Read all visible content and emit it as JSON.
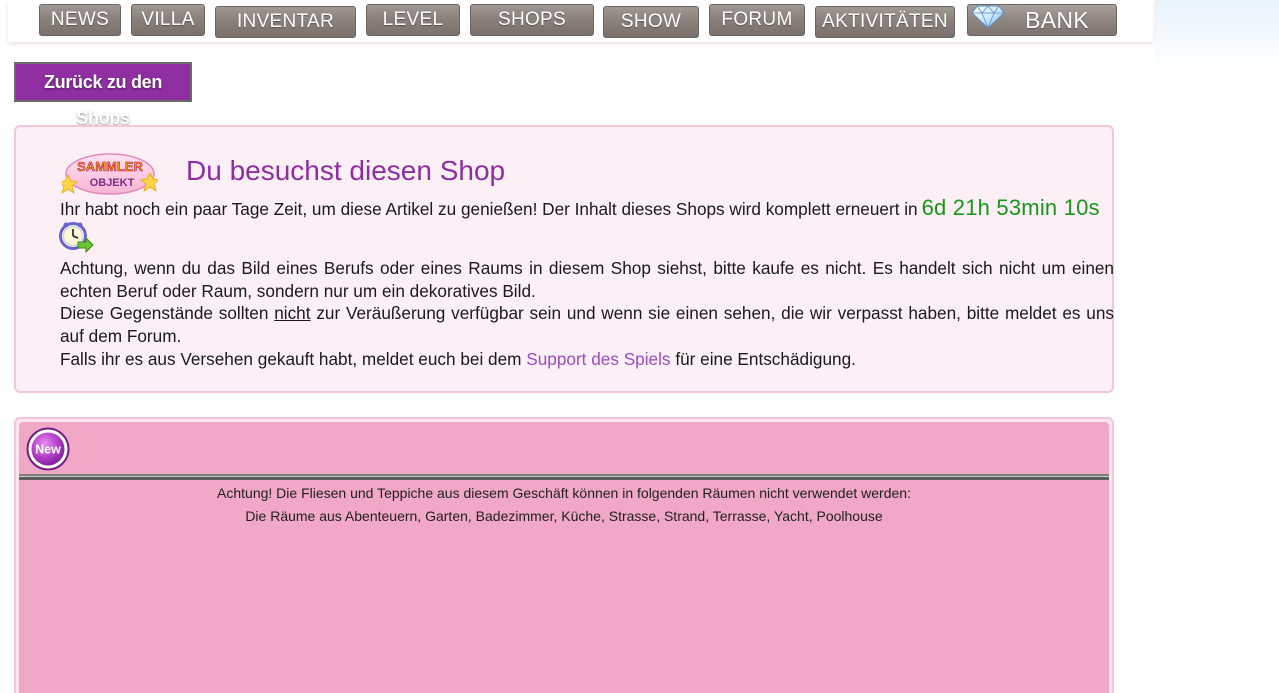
{
  "nav": {
    "items": [
      {
        "label": "NEWS"
      },
      {
        "label": "VILLA"
      },
      {
        "label": "INVENTAR"
      },
      {
        "label": "LEVEL"
      },
      {
        "label": "SHOPS"
      },
      {
        "label": "SHOW"
      },
      {
        "label": "FORUM"
      },
      {
        "label": "AKTIVITÄTEN"
      },
      {
        "label": "BANK",
        "icon": "diamond-icon"
      }
    ]
  },
  "back_button": {
    "label": "Zurück zu den Shops"
  },
  "info": {
    "badge": {
      "line1": "SAMMLER",
      "line2": "OBJEKT"
    },
    "title": "Du besuchst diesen Shop",
    "text_1": "Ihr habt noch ein paar Tage Zeit, um diese Artikel zu genießen! Der Inhalt dieses Shops wird komplett erneuert in",
    "countdown": "6d 21h 53min 10s",
    "clock_icon": "clock-arrow-icon",
    "text_2": "Achtung, wenn du das Bild eines Berufs oder eines Raums in diesem Shop siehst, bitte kaufe es nicht. Es handelt sich nicht um einen echten Beruf oder Raum, sondern nur um ein dekoratives Bild.",
    "text_3a": "Diese Gegenstände sollten",
    "text_3_underlined": "nicht",
    "text_3b": "zur Veräußerung verfügbar sein und wenn sie einen sehen, die wir verpasst haben, bitte meldet es uns auf dem Forum.",
    "text_4a": "Falls ihr es aus Versehen gekauft habt, meldet euch bei dem",
    "support_link": "Support des Spiels",
    "text_4b": "für eine Entschädigung."
  },
  "shop": {
    "new_badge": "New",
    "notice_1": "Achtung! Die Fliesen und Teppiche aus diesem Geschäft können in folgenden Räumen nicht verwendet werden:",
    "notice_2": "Die Räume aus Abenteuern, Garten, Badezimmer, Küche, Strasse, Strand, Terrasse, Yacht, Poolhouse"
  },
  "colors": {
    "accent_purple": "#8e2ea1",
    "countdown_green": "#17971a",
    "link_purple": "#9a4bc6",
    "panel_pink": "#f1a7c6",
    "info_bg": "#fcf0f6"
  }
}
